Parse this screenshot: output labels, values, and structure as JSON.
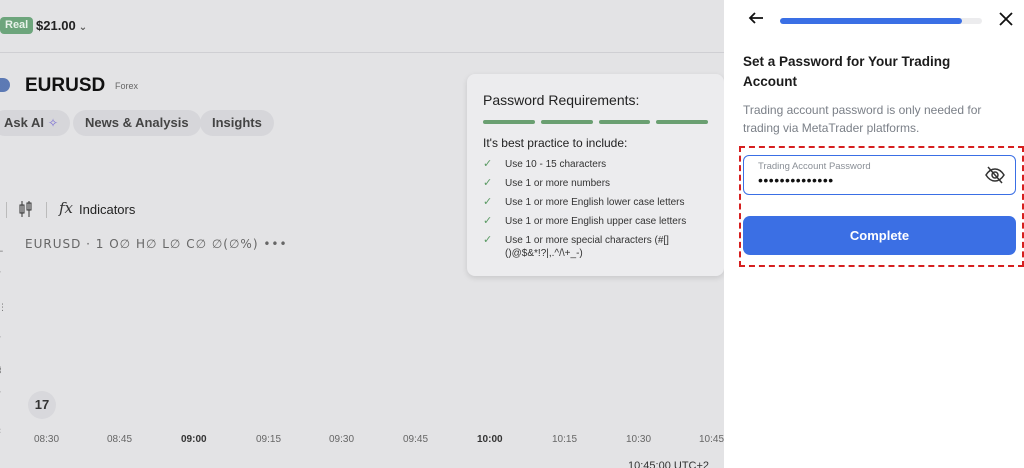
{
  "account": {
    "badge": "Real",
    "balance": "$21.00",
    "chevron": "⌄"
  },
  "instrument": {
    "symbol": "EURUSD",
    "type": "Forex"
  },
  "chips": {
    "ask_ai": "Ask AI",
    "news": "News & Analysis",
    "insights": "Insights"
  },
  "chart_toolbar": {
    "indicators": "Indicators",
    "fx_icon": "fx"
  },
  "ohlc_line": "EURUSD · 1  O∅ H∅ L∅ C∅ ∅(∅%) •••",
  "time_axis": [
    "08:30",
    "08:45",
    "09:00",
    "09:15",
    "09:30",
    "09:45",
    "10:00",
    "10:15",
    "10:30",
    "10:45"
  ],
  "time_axis_bold": [
    "09:00",
    "10:00"
  ],
  "utc_time": "10:45:00 UTC+2",
  "tv_logo": "17",
  "requirements": {
    "title": "Password Requirements:",
    "bars": 4,
    "subtitle": "It's best practice to include:",
    "items": [
      "Use 10 - 15 characters",
      "Use 1 or more numbers",
      "Use 1 or more English lower case letters",
      "Use 1 or more English upper case letters",
      "Use 1 or more special characters (#[]()@$&*!?|,.^/\\+_-)"
    ]
  },
  "panel": {
    "progress_fraction": 0.9,
    "heading": "Set a Password for Your Trading Account",
    "description": "Trading account password is only needed for trading via MetaTrader platforms.",
    "password_label": "Trading Account Password",
    "password_value": "••••••••••••••",
    "complete_label": "Complete"
  },
  "colors": {
    "accent": "#3b6fe4",
    "success": "#6a9f71",
    "highlight_border": "#d61f1f",
    "real_badge": "#6da57c"
  }
}
